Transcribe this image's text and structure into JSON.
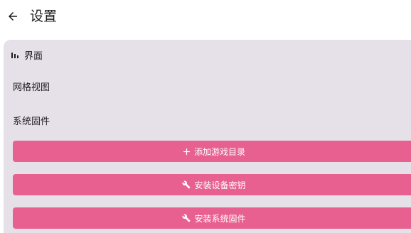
{
  "header": {
    "title": "设置",
    "back_icon": "arrow-left-icon"
  },
  "section": {
    "title": "界面",
    "icon": "bar-chart-icon",
    "items": [
      {
        "label": "网格视图"
      },
      {
        "label": "系统固件"
      }
    ]
  },
  "actions": [
    {
      "label": "添加游戏目录",
      "icon": "plus-icon"
    },
    {
      "label": "安装设备密钥",
      "icon": "wrench-icon"
    },
    {
      "label": "安装系统固件",
      "icon": "wrench-icon"
    }
  ],
  "colors": {
    "accent": "#e8608f",
    "card_background": "#e6e1e8",
    "text": "#1c1b1f"
  }
}
